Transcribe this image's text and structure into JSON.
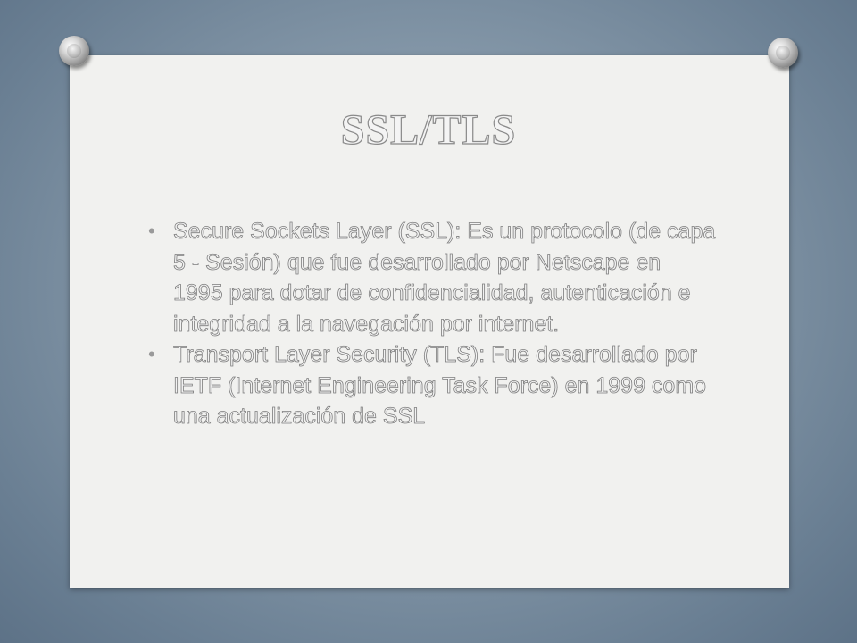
{
  "slide": {
    "title": "SSL/TLS",
    "bullets": [
      {
        "text": "Secure Sockets Layer (SSL): Es un protocolo (de capa 5 - Sesión) que fue desarrollado por Netscape en 1995 para dotar de confidencialidad, autenticación e integridad a la navegación por internet."
      },
      {
        "text": "Transport Layer Security (TLS): Fue desarrollado por IETF (Internet Engineering Task Force) en 1999 como una actualización de SSL"
      }
    ],
    "bullet_symbol": "•"
  },
  "colors": {
    "background": "#8497a8",
    "board": "#f1f1ef",
    "text_fill": "#f2f2f2",
    "text_outline": "#7d7d7d"
  },
  "icons": {
    "pins": [
      "push-pin-icon",
      "push-pin-icon"
    ]
  }
}
